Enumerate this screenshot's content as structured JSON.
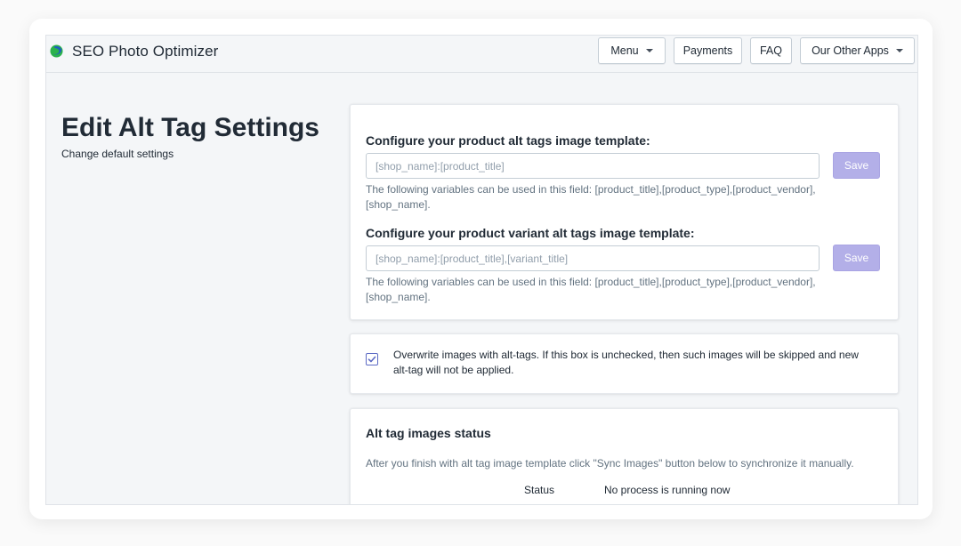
{
  "header": {
    "app_title": "SEO Photo Optimizer",
    "logo_icon": "brand-logo-icon",
    "nav": {
      "menu": "Menu",
      "payments": "Payments",
      "faq": "FAQ",
      "other_apps": "Our Other Apps"
    }
  },
  "page": {
    "title": "Edit Alt Tag Settings",
    "subtitle": "Change default settings"
  },
  "templates": {
    "product": {
      "label": "Configure your product alt tags image template:",
      "placeholder": "[shop_name]:[product_title]",
      "save_label": "Save",
      "help": "The following variables can be used in this field: [product_title],[product_type],[product_vendor],[shop_name]."
    },
    "variant": {
      "label": "Configure your product variant alt tags image template:",
      "placeholder": "[shop_name]:[product_title],[variant_title]",
      "save_label": "Save",
      "help": "The following variables can be used in this field: [product_title],[product_type],[product_vendor],[shop_name]."
    }
  },
  "overwrite": {
    "checked": true,
    "text": "Overwrite images with alt-tags. If this box is unchecked, then such images will be skipped and new alt-tag will not be applied."
  },
  "status": {
    "title": "Alt tag images status",
    "description": "After you finish with alt tag image template click \"Sync Images\" button below to synchronize it manually.",
    "label": "Status",
    "value": "No process is running now"
  },
  "colors": {
    "save_button": "#b3afe8",
    "checkbox_accent": "#5c6ac4",
    "logo_green": "#2bb24c",
    "logo_blue": "#1f5fbf"
  }
}
